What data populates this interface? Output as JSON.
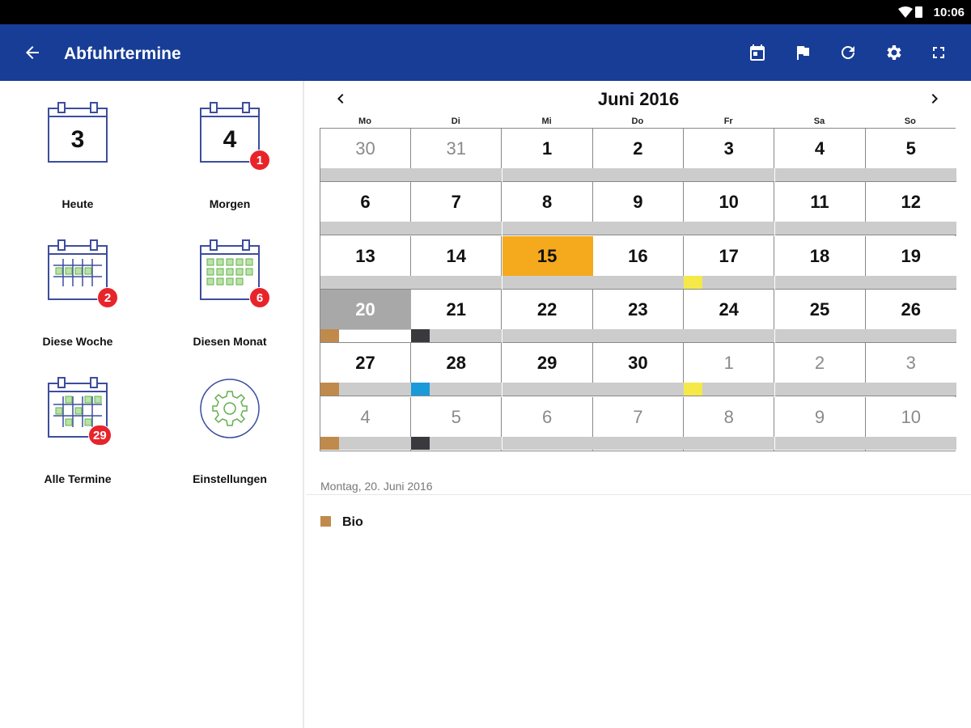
{
  "statusbar": {
    "time": "10:06"
  },
  "appbar": {
    "title": "Abfuhrtermine",
    "color": "#183d96",
    "actions": [
      "calendar-today-icon",
      "flag-icon",
      "refresh-icon",
      "settings-icon",
      "fullscreen-icon"
    ]
  },
  "tiles": [
    {
      "label": "Heute",
      "date": "3",
      "badge": null
    },
    {
      "label": "Morgen",
      "date": "4",
      "badge": "1"
    },
    {
      "label": "Diese Woche",
      "date": null,
      "badge": "2"
    },
    {
      "label": "Diesen Monat",
      "date": null,
      "badge": "6"
    },
    {
      "label": "Alle Termine",
      "date": null,
      "badge": "29"
    },
    {
      "label": "Einstellungen",
      "date": null,
      "badge": null
    }
  ],
  "calendar": {
    "month": "Juni 2016",
    "weekdays": [
      "Mo",
      "Di",
      "Mi",
      "Do",
      "Fr",
      "Sa",
      "So"
    ],
    "colors": {
      "bio": "#c08a4c",
      "rest": "#3a3a3e",
      "papier": "#1a9ad8",
      "gelb": "#f5e94a",
      "highlight": "#f5a91d",
      "selected": "#a8a8a8"
    },
    "weeks": [
      [
        {
          "d": "30",
          "o": true
        },
        {
          "d": "31",
          "o": true
        },
        {
          "d": "1"
        },
        {
          "d": "2"
        },
        {
          "d": "3"
        },
        {
          "d": "4"
        },
        {
          "d": "5"
        }
      ],
      [
        {
          "d": "6"
        },
        {
          "d": "7"
        },
        {
          "d": "8"
        },
        {
          "d": "9"
        },
        {
          "d": "10"
        },
        {
          "d": "11"
        },
        {
          "d": "12"
        }
      ],
      [
        {
          "d": "13"
        },
        {
          "d": "14"
        },
        {
          "d": "15",
          "h": true
        },
        {
          "d": "16"
        },
        {
          "d": "17",
          "c": "gelb"
        },
        {
          "d": "18"
        },
        {
          "d": "19"
        }
      ],
      [
        {
          "d": "20",
          "s": true,
          "c": "bio",
          "w": true
        },
        {
          "d": "21",
          "c": "rest"
        },
        {
          "d": "22"
        },
        {
          "d": "23"
        },
        {
          "d": "24"
        },
        {
          "d": "25"
        },
        {
          "d": "26"
        }
      ],
      [
        {
          "d": "27",
          "c": "bio"
        },
        {
          "d": "28",
          "c": "papier"
        },
        {
          "d": "29"
        },
        {
          "d": "30"
        },
        {
          "d": "1",
          "o": true,
          "c": "gelb"
        },
        {
          "d": "2",
          "o": true
        },
        {
          "d": "3",
          "o": true
        }
      ],
      [
        {
          "d": "4",
          "o": true,
          "c": "bio"
        },
        {
          "d": "5",
          "o": true,
          "c": "rest"
        },
        {
          "d": "6",
          "o": true
        },
        {
          "d": "7",
          "o": true
        },
        {
          "d": "8",
          "o": true
        },
        {
          "d": "9",
          "o": true
        },
        {
          "d": "10",
          "o": true
        }
      ]
    ]
  },
  "detail": {
    "date": "Montag, 20. Juni 2016",
    "items": [
      {
        "label": "Bio",
        "color": "#c08a4c"
      }
    ]
  }
}
